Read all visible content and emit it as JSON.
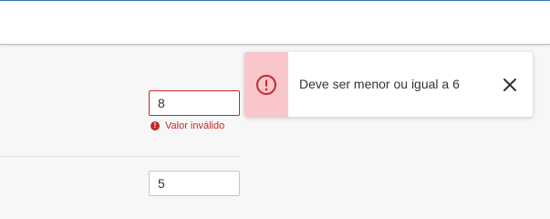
{
  "form": {
    "field1": {
      "value": "8"
    },
    "field1_error": {
      "text": "Valor inválido"
    },
    "field2": {
      "value": "5"
    }
  },
  "toast": {
    "type": "error",
    "icon": "exclamation-circle-icon",
    "message": "Deve ser menor ou igual a 6",
    "close_icon": "close-icon"
  },
  "colors": {
    "error": "#c62828",
    "toast_stripe": "#f8c6cb",
    "accent_line": "#2f7cc0"
  }
}
